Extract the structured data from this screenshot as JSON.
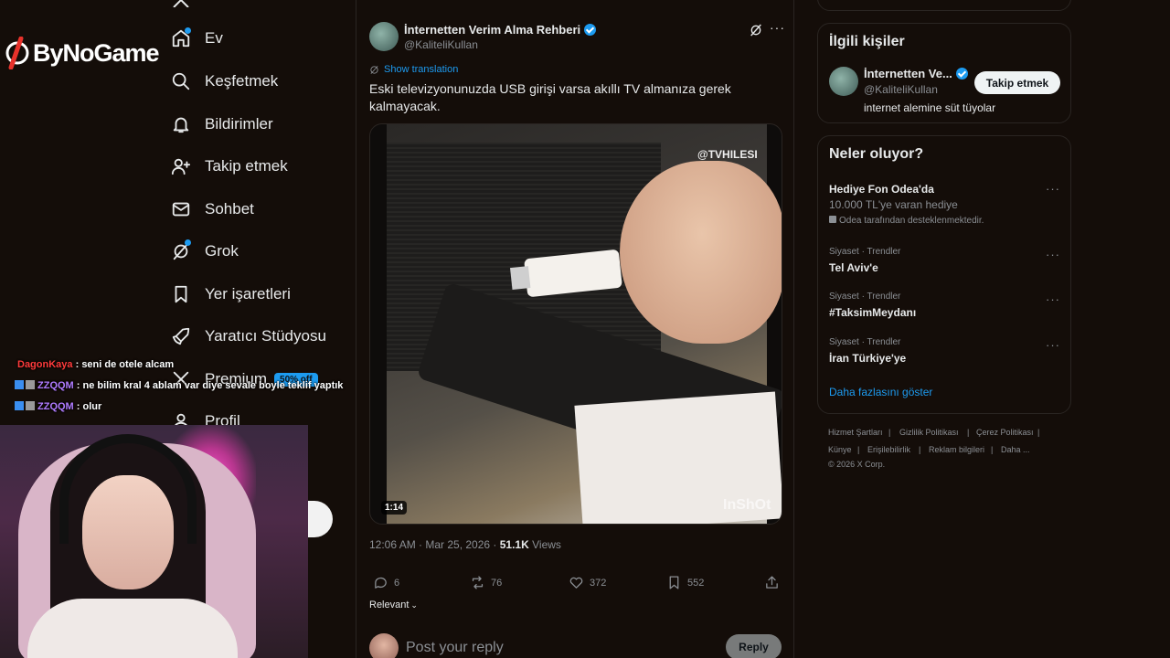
{
  "brand": {
    "name": "ByNoGame"
  },
  "nav": {
    "items": [
      {
        "label": "Ev",
        "icon": "home-icon"
      },
      {
        "label": "Keşfetmek",
        "icon": "search-icon"
      },
      {
        "label": "Bildirimler",
        "icon": "bell-icon"
      },
      {
        "label": "Takip etmek",
        "icon": "add-user-icon"
      },
      {
        "label": "Sohbet",
        "icon": "mail-icon"
      },
      {
        "label": "Grok",
        "icon": "grok-icon"
      },
      {
        "label": "Yer işaretleri",
        "icon": "bookmark-icon"
      },
      {
        "label": "Yaratıcı Stüdyosu",
        "icon": "rocket-icon"
      },
      {
        "label": "Premium",
        "icon": "x-logo-icon",
        "badge": "50% off"
      },
      {
        "label": "Profil",
        "icon": "profile-icon"
      }
    ]
  },
  "tweet": {
    "author_name": "İnternetten Verim Alma Rehberi",
    "author_handle": "@KaliteliKullan",
    "show_translation": "Show translation",
    "text": "Eski televizyonunuzda USB girişi varsa akıllı TV almanıza gerek kalmayacak.",
    "video_watermark": "@TVHILESI",
    "video_duration": "1:14",
    "video_brand": "InShOt",
    "time": "12:06 AM · Mar 25, 2026 · ",
    "views_count": "51.1K",
    "views_label": " Views",
    "replies": "6",
    "reposts": "76",
    "likes": "372",
    "bookmarks": "552",
    "sort_label": "Relevant"
  },
  "reply": {
    "placeholder": "Post your reply",
    "button": "Reply"
  },
  "related": {
    "title": "İlgili kişiler",
    "name": "İnternetten Ve...",
    "handle": "@KaliteliKullan",
    "bio": "internet alemine süt tüyolar",
    "follow_label": "Takip etmek"
  },
  "trends": {
    "title": "Neler oluyor?",
    "promoted": {
      "name": "Hediye Fon Odea'da",
      "desc": "10.000 TL'ye varan hediye",
      "sponsor": "Odea tarafından desteklenmektedir."
    },
    "items": [
      {
        "category": "Siyaset · Trendler",
        "name": "Tel Aviv'e"
      },
      {
        "category": "Siyaset · Trendler",
        "name": "#TaksimMeydanı"
      },
      {
        "category": "Siyaset · Trendler",
        "name": "İran Türkiye'ye"
      }
    ],
    "show_more": "Daha fazlasını göster"
  },
  "footer": {
    "links": [
      "Hizmet Şartları",
      "Gizlilik Politikası",
      "Çerez Politikası",
      "Künye",
      "Erişilebilirlik",
      "Reklam bilgileri",
      "Daha ..."
    ],
    "copyright": "© 2026 X Corp."
  },
  "chat": [
    {
      "user": "DagonKaya",
      "message": ": seni de otele alcam"
    },
    {
      "user": "ZZQQM",
      "message": ": ne bilim kral 4 ablam var diye sevale boyle teklif yaptık"
    },
    {
      "user": "ZZQQM",
      "message": ": olur"
    }
  ],
  "colors": {
    "accent": "#1d9bf0",
    "background": "#140d09",
    "chat_user": "#b07cff",
    "chat_user_red": "#ff3b3b"
  }
}
